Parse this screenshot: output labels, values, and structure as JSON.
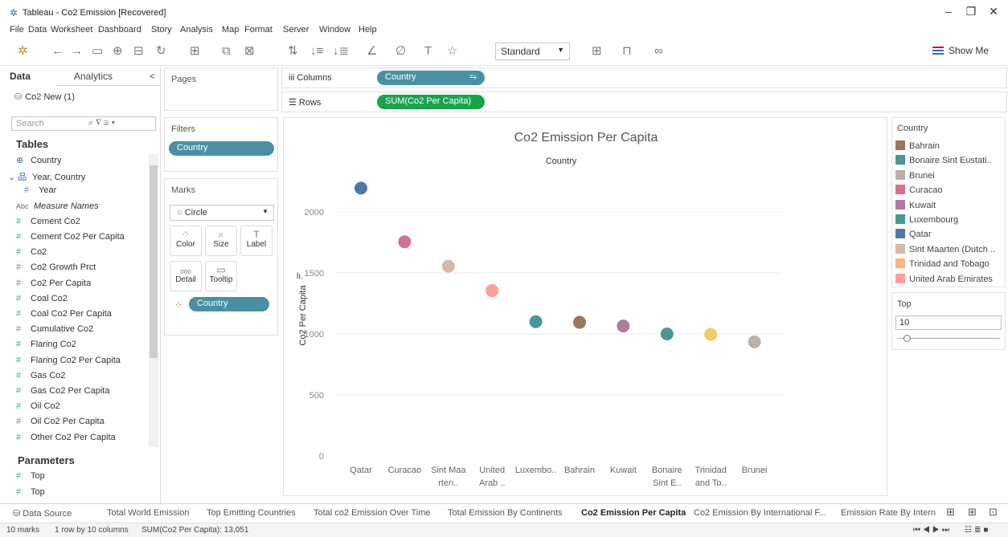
{
  "window": {
    "title": "Tableau - Co2 Emission [Recovered]",
    "controls": [
      "–",
      "❐",
      "✕"
    ]
  },
  "menu": [
    "File",
    "Data",
    "Worksheet",
    "Dashboard",
    "Story",
    "Analysis",
    "Map",
    "Format",
    "Server",
    "Window",
    "Help"
  ],
  "toolbar": {
    "fit_select": "Standard",
    "show_me": "Show Me"
  },
  "data_pane": {
    "tab_data": "Data",
    "tab_analytics": "Analytics",
    "collapse": "<",
    "datasource": "Co2 New (1)",
    "search_placeholder": "Search",
    "tables_header": "Tables",
    "fields": [
      {
        "icon": "⊕",
        "name": "Country"
      },
      {
        "icon": "⌄ 品",
        "name": "Year, Country"
      },
      {
        "icon": "#",
        "name": "Year",
        "indent": true
      },
      {
        "icon": "Abc",
        "name": "Measure Names",
        "italic": true
      },
      {
        "icon": "#",
        "name": "Cement Co2"
      },
      {
        "icon": "#",
        "name": "Cement Co2 Per Capita"
      },
      {
        "icon": "#",
        "name": "Co2"
      },
      {
        "icon": "#",
        "name": "Co2 Growth Prct"
      },
      {
        "icon": "#",
        "name": "Co2 Per Capita"
      },
      {
        "icon": "#",
        "name": "Coal Co2"
      },
      {
        "icon": "#",
        "name": "Coal Co2 Per Capita"
      },
      {
        "icon": "#",
        "name": "Cumulative Co2"
      },
      {
        "icon": "#",
        "name": "Flaring Co2"
      },
      {
        "icon": "#",
        "name": "Flaring Co2 Per Capita"
      },
      {
        "icon": "#",
        "name": "Gas Co2"
      },
      {
        "icon": "#",
        "name": "Gas Co2 Per Capita"
      },
      {
        "icon": "#",
        "name": "Oil Co2"
      },
      {
        "icon": "#",
        "name": "Oil Co2 Per Capita"
      },
      {
        "icon": "#",
        "name": "Other Co2 Per Capita"
      }
    ],
    "parameters_header": "Parameters",
    "parameters": [
      "Top",
      "Top"
    ]
  },
  "shelves": {
    "pages": "Pages",
    "columns_label": "Columns",
    "columns_pill": "Country",
    "rows_label": "Rows",
    "rows_pill": "SUM(Co2 Per Capita)",
    "filters": "Filters",
    "filter_pill": "Country",
    "marks": "Marks",
    "mark_type": "Circle",
    "mark_buttons": [
      {
        "icon": "⁘",
        "label": "Color"
      },
      {
        "icon": "⌕",
        "label": "Size"
      },
      {
        "icon": "T",
        "label": "Label"
      },
      {
        "icon": "ₒₒₒ",
        "label": "Detail"
      },
      {
        "icon": "▭",
        "label": "Tooltip"
      }
    ],
    "mark_pill": "Country"
  },
  "chart_data": {
    "type": "scatter",
    "title": "Co2 Emission Per Capita",
    "subtitle": "Country",
    "ylabel": "Co2 Per Capita",
    "ylim": [
      0,
      2300
    ],
    "yticks": [
      0,
      500,
      1000,
      1500,
      2000
    ],
    "ytick_labels": [
      "0",
      "500",
      "1000",
      "1500",
      "2000"
    ],
    "categories": [
      "Qatar",
      "Curacao",
      "Sint Maarten..",
      "United Arab ..",
      "Luxembo..",
      "Bahrain",
      "Kuwait",
      "Bonaire Sint E..",
      "Trinidad and To..",
      "Brunei"
    ],
    "category_lines": [
      [
        "Qatar"
      ],
      [
        "Curacao"
      ],
      [
        "Sint Maa",
        "rten.."
      ],
      [
        "United",
        "Arab .."
      ],
      [
        "Luxembo.."
      ],
      [
        "Bahrain"
      ],
      [
        "Kuwait"
      ],
      [
        "Bonaire",
        "Sint E.."
      ],
      [
        "Trinidad",
        "and To.."
      ],
      [
        "Brunei"
      ]
    ],
    "values": [
      2195,
      1755,
      1555,
      1355,
      1100,
      1095,
      1065,
      1000,
      995,
      935
    ],
    "colors": [
      "#4e79a7",
      "#d37295",
      "#d4b9a8",
      "#ff9d9a",
      "#499894",
      "#9c755f",
      "#b07aa1",
      "#499894",
      "#f1ce63",
      "#bab0ac"
    ]
  },
  "legend": {
    "title": "Country",
    "items": [
      {
        "label": "Bahrain",
        "color": "#9c755f"
      },
      {
        "label": "Bonaire Sint Eustati..",
        "color": "#499894"
      },
      {
        "label": "Brunei",
        "color": "#bab0ac"
      },
      {
        "label": "Curacao",
        "color": "#d37295"
      },
      {
        "label": "Kuwait",
        "color": "#b07aa1"
      },
      {
        "label": "Luxembourg",
        "color": "#499894"
      },
      {
        "label": "Qatar",
        "color": "#4e79a7"
      },
      {
        "label": "Sint Maarten (Dutch ..",
        "color": "#d4b9a8"
      },
      {
        "label": "Trinidad and Tobago",
        "color": "#f7b880"
      },
      {
        "label": "United Arab Emirates",
        "color": "#ff9d9a"
      }
    ]
  },
  "top_param": {
    "title": "Top",
    "value": "10"
  },
  "sheets": {
    "data_source": "Data Source",
    "tabs": [
      "Total World Emission",
      "Top Emitting Countries",
      "Total co2 Emission Over Time",
      "Total Emission By Continents",
      "Co2 Emission Per Capita",
      "Co2 Emission By International F...",
      "Emission Rate By Intern"
    ],
    "active": "Co2 Emission Per Capita"
  },
  "status": {
    "marks": "10 marks",
    "rows": "1 row by 10 columns",
    "sum": "SUM(Co2 Per Capita): 13,051"
  }
}
